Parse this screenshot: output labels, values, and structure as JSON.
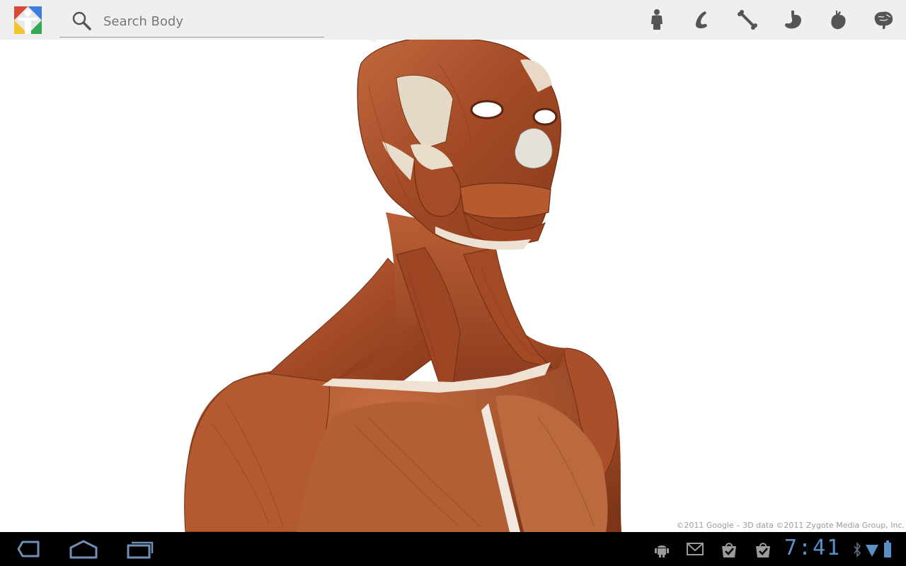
{
  "app": {
    "logo_icon": "google-body-logo-icon"
  },
  "search": {
    "placeholder": "Search Body",
    "value": "",
    "icon": "search-icon"
  },
  "layers": [
    {
      "name": "skin-layer",
      "icon": "figure-icon"
    },
    {
      "name": "muscle-layer",
      "icon": "muscle-icon"
    },
    {
      "name": "skeleton-layer",
      "icon": "bone-icon"
    },
    {
      "name": "organ-layer",
      "icon": "stomach-icon"
    },
    {
      "name": "circulatory-layer",
      "icon": "heart-icon"
    },
    {
      "name": "nervous-layer",
      "icon": "brain-icon"
    }
  ],
  "viewer": {
    "model": "human upper body musculature",
    "copyright": "©2011 Google – 3D data ©2011 Zygote Media Group, Inc."
  },
  "system_bar": {
    "nav": [
      "back-icon",
      "home-icon",
      "recent-apps-icon"
    ],
    "notifications": [
      "android-debug-icon",
      "gmail-icon",
      "market-update-icon",
      "market-update-icon"
    ],
    "time": "7:41",
    "status_icons": [
      "bluetooth-icon",
      "wifi-icon",
      "battery-icon"
    ],
    "accent": "#5b8fc8"
  }
}
